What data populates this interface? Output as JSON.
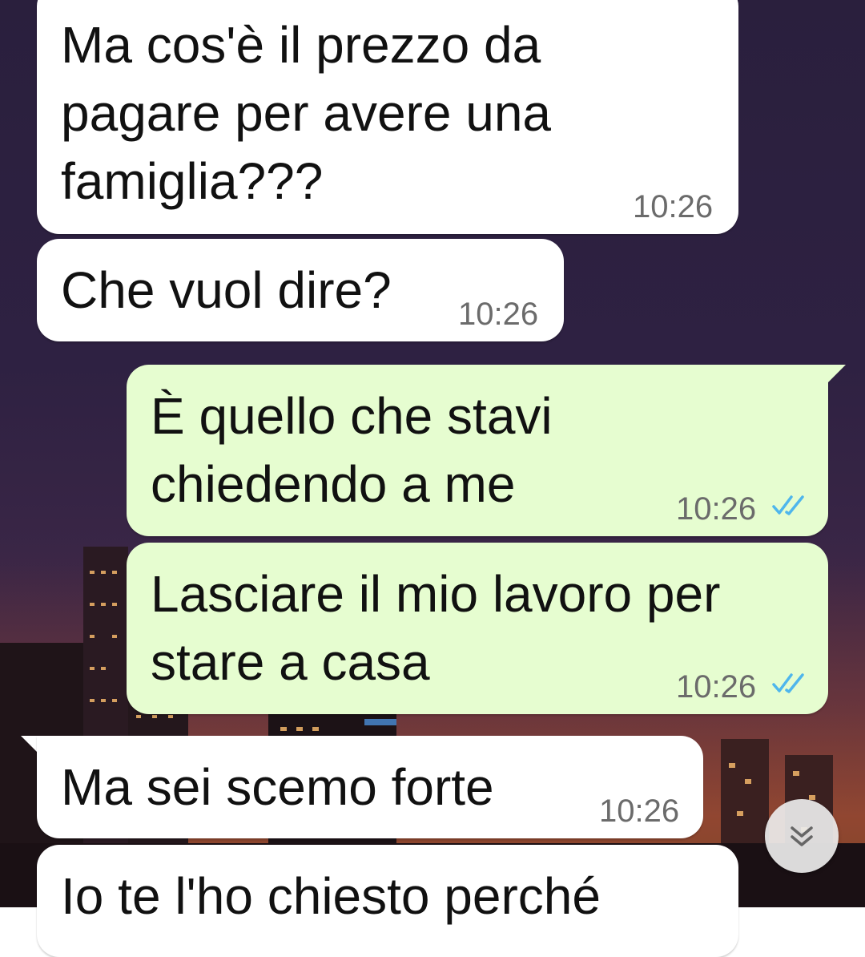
{
  "messages": [
    {
      "direction": "incoming",
      "text": "Ma cos'è il prezzo da\npagare per avere una\nfamiglia???",
      "time": "10:26"
    },
    {
      "direction": "incoming",
      "text": "Che vuol dire?",
      "time": "10:26"
    },
    {
      "direction": "outgoing",
      "text": "È quello che stavi\nchiedendo a me",
      "time": "10:26",
      "status": "read"
    },
    {
      "direction": "outgoing",
      "text": "Lasciare il mio lavoro per\nstare a casa",
      "time": "10:26",
      "status": "read"
    },
    {
      "direction": "incoming",
      "text": "Ma sei scemo forte",
      "time": "10:26"
    },
    {
      "direction": "incoming",
      "text": "Io te l'ho chiesto perché",
      "time": ""
    }
  ],
  "icons": {
    "read_ticks": "double-check-icon",
    "scroll_down": "double-chevron-down-icon"
  },
  "colors": {
    "incoming_bubble": "#ffffff",
    "outgoing_bubble": "#e6fdd0",
    "read_tick": "#4fb6ec",
    "time_text": "#6b6b6b"
  }
}
